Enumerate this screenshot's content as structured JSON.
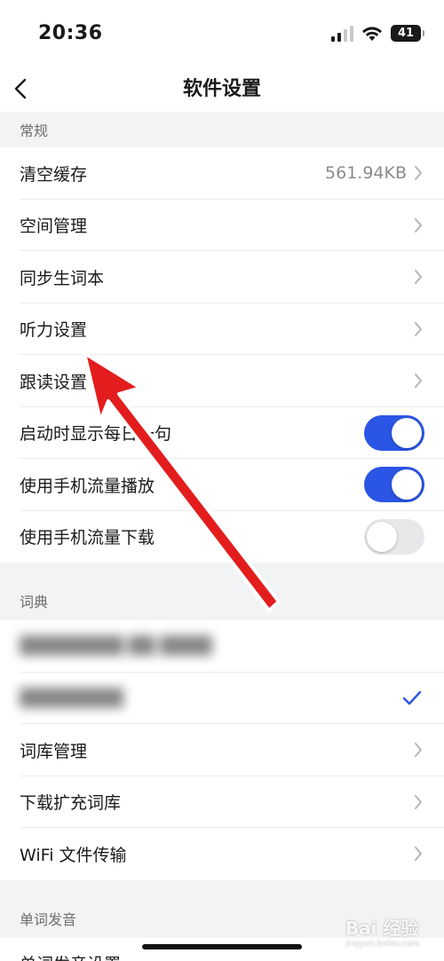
{
  "status": {
    "time": "20:36",
    "battery": "41"
  },
  "nav": {
    "title": "软件设置"
  },
  "sections": {
    "general": {
      "header": "常规",
      "clear_cache": {
        "label": "清空缓存",
        "value": "561.94KB"
      },
      "space_manage": {
        "label": "空间管理"
      },
      "sync_vocab": {
        "label": "同步生词本"
      },
      "listening": {
        "label": "听力设置"
      },
      "follow_read": {
        "label": "跟读设置"
      },
      "daily_sentence": {
        "label": "启动时显示每日一句",
        "on": true
      },
      "mobile_play": {
        "label": "使用手机流量播放",
        "on": true
      },
      "mobile_download": {
        "label": "使用手机流量下载",
        "on": false
      }
    },
    "dictionary": {
      "header": "词典",
      "blurred_1": "████████ ██ ████",
      "blurred_2": "████████",
      "lexicon_manage": {
        "label": "词库管理"
      },
      "download_ext": {
        "label": "下载扩充词库"
      },
      "wifi_transfer": {
        "label": "WiFi 文件传输"
      }
    },
    "pronunciation": {
      "header": "单词发音",
      "settings": {
        "label": "单词发音设置"
      }
    }
  },
  "watermark": {
    "text": "Bai 经验",
    "sub": "jingyan.baidu.com"
  },
  "colors": {
    "accent": "#2a55e5",
    "arrow": "#e31d1d",
    "section_bg": "#f2f3f5"
  }
}
